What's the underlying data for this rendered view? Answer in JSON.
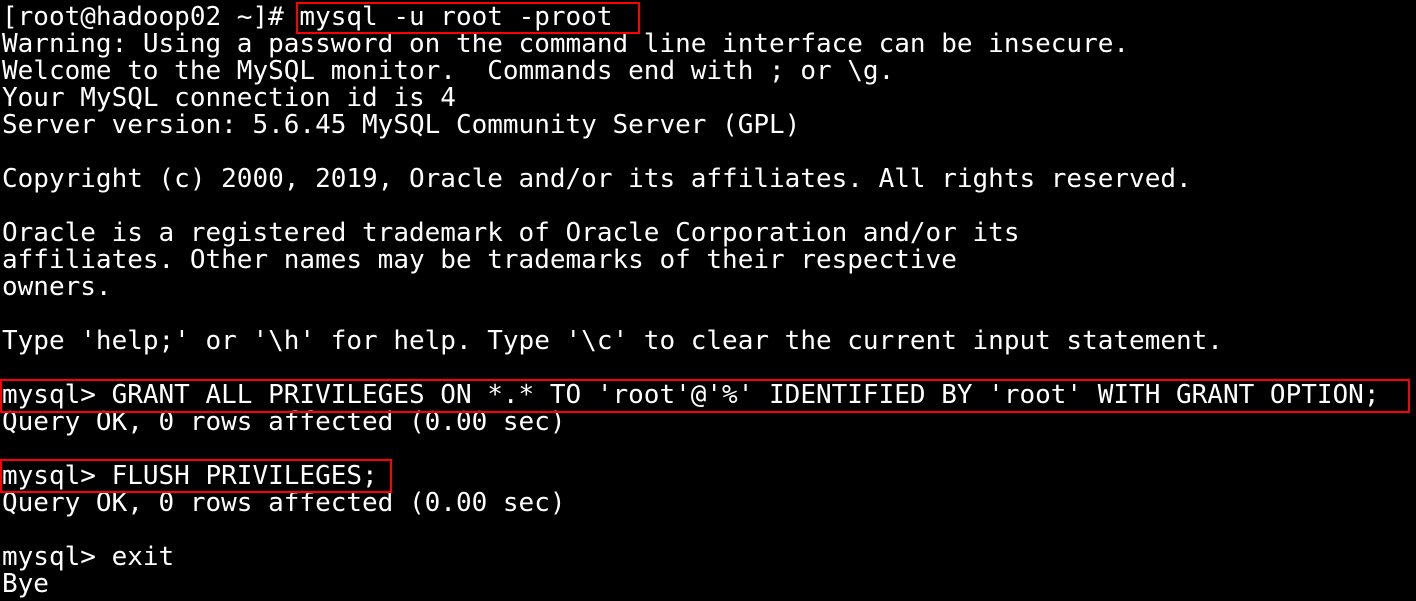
{
  "terminal": {
    "background": "#000000",
    "foreground": "#ffffff",
    "highlight_color": "#ff0000",
    "lines": [
      {
        "prompt": "[root@hadoop02 ~]# ",
        "command": "mysql -u root -proot"
      },
      "Warning: Using a password on the command line interface can be insecure.",
      "Welcome to the MySQL monitor.  Commands end with ; or \\g.",
      "Your MySQL connection id is 4",
      "Server version: 5.6.45 MySQL Community Server (GPL)",
      "",
      "Copyright (c) 2000, 2019, Oracle and/or its affiliates. All rights reserved.",
      "",
      "Oracle is a registered trademark of Oracle Corporation and/or its",
      "affiliates. Other names may be trademarks of their respective",
      "owners.",
      "",
      "Type 'help;' or '\\h' for help. Type '\\c' to clear the current input statement.",
      "",
      "mysql> GRANT ALL PRIVILEGES ON *.* TO 'root'@'%' IDENTIFIED BY 'root' WITH GRANT OPTION;",
      "Query OK, 0 rows affected (0.00 sec)",
      "mysql> FLUSH PRIVILEGES;",
      "Query OK, 0 rows affected (0.00 sec)",
      "",
      "mysql> exit",
      "Bye"
    ]
  }
}
